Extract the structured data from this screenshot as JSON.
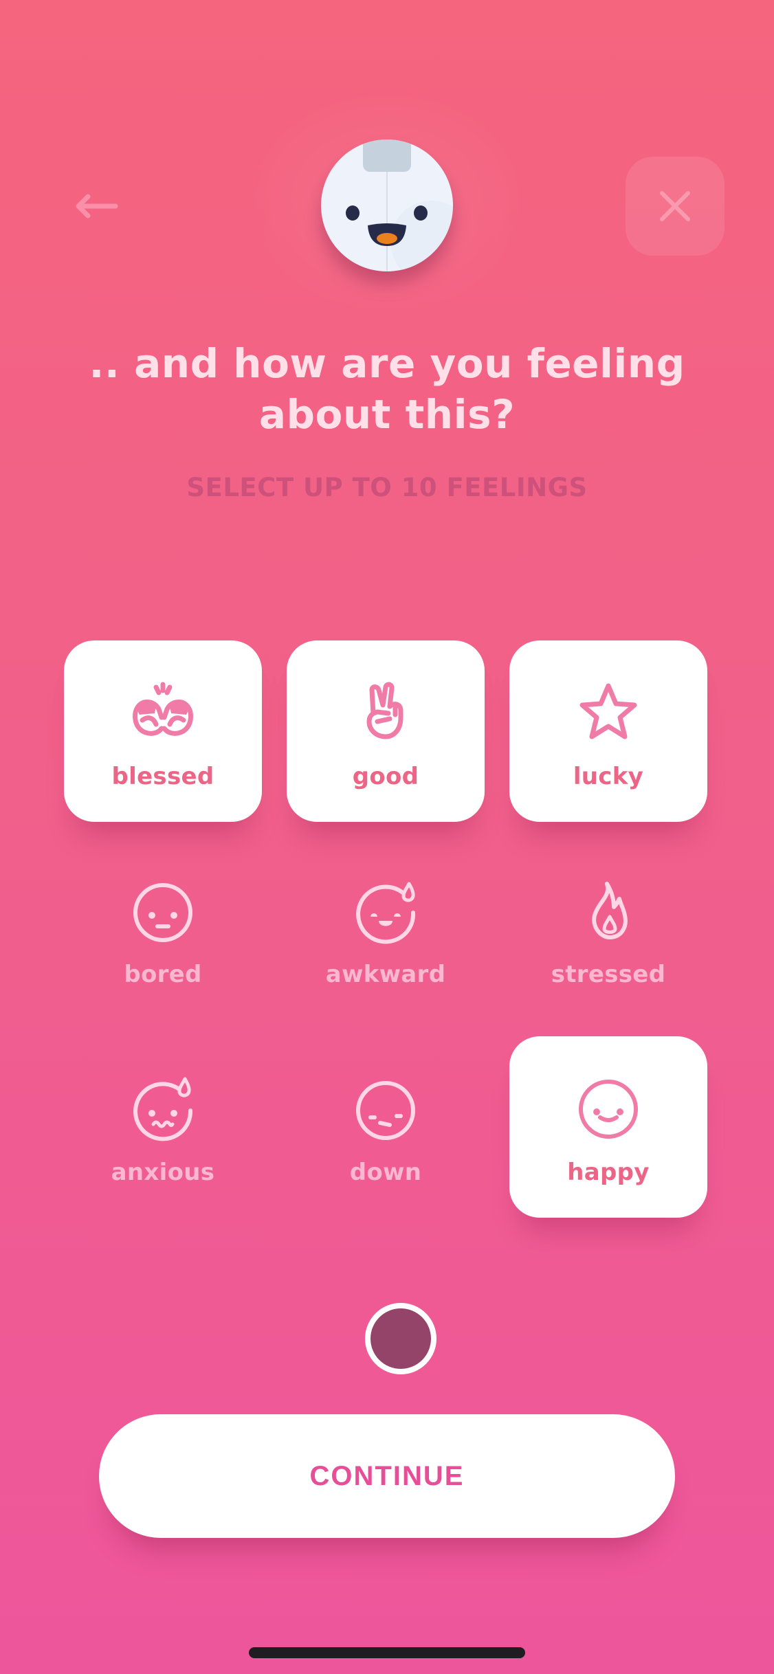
{
  "header": {
    "back_icon": "arrow-left-icon",
    "close_icon": "close-icon",
    "mascot": "smiling-robot-mascot"
  },
  "prompt": {
    "title_line1": ".. and how are you feeling",
    "title_line2": "about this?",
    "subtitle": "SELECT UP TO 10 FEELINGS"
  },
  "feelings": [
    {
      "label": "blessed",
      "icon": "raised-hands-icon",
      "selected": true
    },
    {
      "label": "good",
      "icon": "victory-hand-icon",
      "selected": true
    },
    {
      "label": "lucky",
      "icon": "star-icon",
      "selected": true
    },
    {
      "label": "bored",
      "icon": "bored-face-icon",
      "selected": false
    },
    {
      "label": "awkward",
      "icon": "sweat-smile-face-icon",
      "selected": false
    },
    {
      "label": "stressed",
      "icon": "flame-icon",
      "selected": false
    },
    {
      "label": "anxious",
      "icon": "anxious-face-icon",
      "selected": false
    },
    {
      "label": "down",
      "icon": "down-face-icon",
      "selected": false
    },
    {
      "label": "happy",
      "icon": "happy-face-icon",
      "selected": true
    }
  ],
  "mood_dot": {
    "color": "#944468"
  },
  "continue_button": {
    "label": "CONTINUE"
  },
  "colors": {
    "background_top": "#F5657E",
    "background_bottom": "#EE569C",
    "accent": "#EC6486",
    "button_text": "#E74E98",
    "unselected_text": "#FBB6D0"
  }
}
